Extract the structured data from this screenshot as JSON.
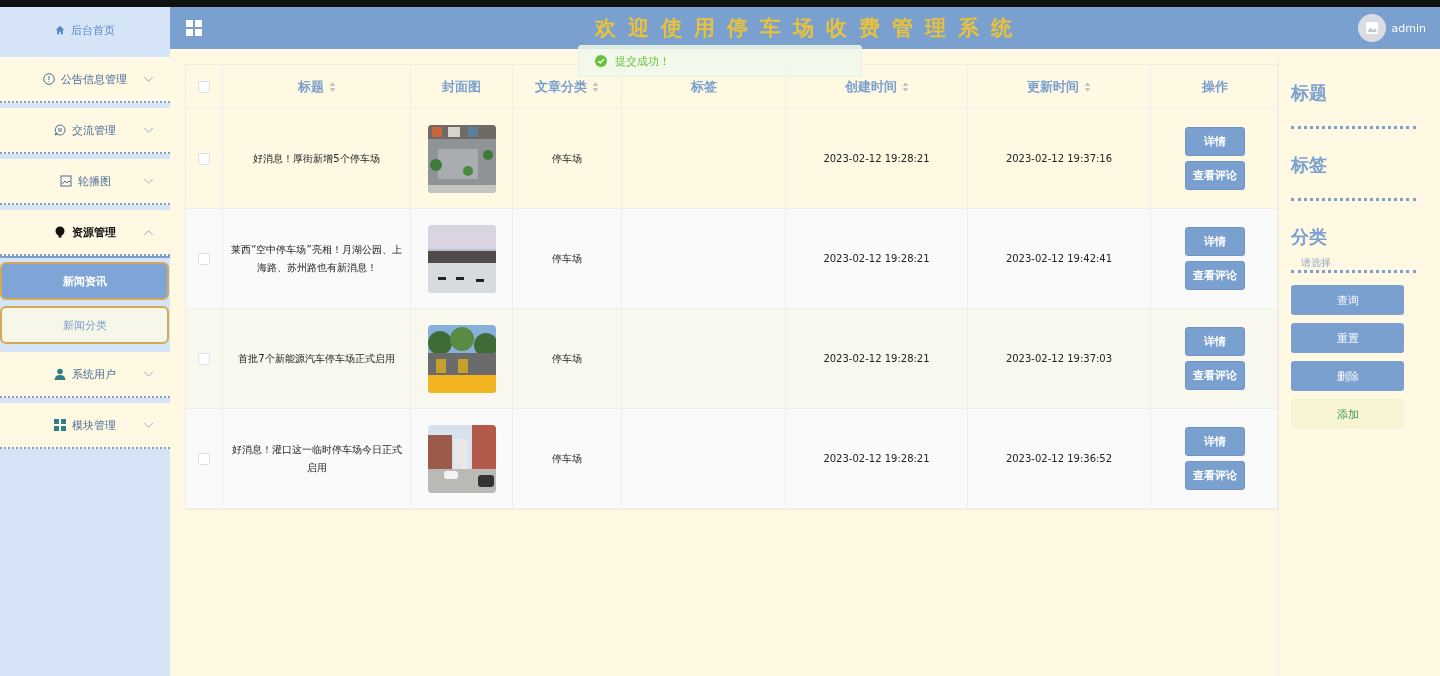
{
  "header": {
    "home": "后台首页",
    "title": "欢迎使用停车场收费管理系统",
    "user": "admin"
  },
  "toast": {
    "message": "提交成功！"
  },
  "sidebar": {
    "items": [
      {
        "label": "公告信息管理",
        "expanded": false
      },
      {
        "label": "交流管理",
        "expanded": false
      },
      {
        "label": "轮播图",
        "expanded": false
      },
      {
        "label": "资源管理",
        "expanded": true,
        "children": [
          {
            "label": "新闻资讯",
            "selected": true
          },
          {
            "label": "新闻分类",
            "selected": false
          }
        ]
      },
      {
        "label": "系统用户",
        "expanded": false
      },
      {
        "label": "模块管理",
        "expanded": false
      }
    ]
  },
  "table": {
    "select_all": {
      "checked": false
    },
    "columns": [
      {
        "label": "标题",
        "sortable": true
      },
      {
        "label": "封面图",
        "sortable": false
      },
      {
        "label": "文章分类",
        "sortable": true
      },
      {
        "label": "标签",
        "sortable": false
      },
      {
        "label": "创建时间",
        "sortable": true
      },
      {
        "label": "更新时间",
        "sortable": true
      },
      {
        "label": "操作",
        "sortable": false
      }
    ],
    "rows": [
      {
        "checked": false,
        "title": "好消息！厚街新增5个停车场",
        "cover": {
          "kind": "picture"
        },
        "category": "停车场",
        "created": "2023-02-12 19:28:21",
        "updated": "2023-02-12 19:37:16",
        "actions": [
          "详情",
          "查看评论"
        ]
      },
      {
        "checked": false,
        "title": "莱西“空中停车场”亮相！月湖公园、上海路、苏州路也有新消息！",
        "cover": {
          "kind": "picture"
        },
        "category": "停车场",
        "created": "2023-02-12 19:28:21",
        "updated": "2023-02-12 19:42:41",
        "actions": [
          "详情",
          "查看评论"
        ]
      },
      {
        "checked": false,
        "title": "首批7个新能源汽车停车场正式启用",
        "cover": {
          "kind": "picture"
        },
        "category": "停车场",
        "created": "2023-02-12 19:28:21",
        "updated": "2023-02-12 19:37:03",
        "actions": [
          "详情",
          "查看评论"
        ]
      },
      {
        "checked": false,
        "title": "好消息！灌口这一临时停车场今日正式启用",
        "cover": {
          "kind": "picture"
        },
        "category": "停车场",
        "created": "2023-02-12 19:28:21",
        "updated": "2023-02-12 19:36:52",
        "actions": [
          "详情",
          "查看评论"
        ]
      }
    ]
  },
  "filters": {
    "fields": [
      {
        "label": "标题"
      },
      {
        "label": "标签"
      },
      {
        "label": "分类",
        "placeholder": "请选择"
      }
    ],
    "buttons": [
      {
        "label": "查询",
        "kind": "primary"
      },
      {
        "label": "重置",
        "kind": "primary"
      },
      {
        "label": "删除",
        "kind": "primary"
      },
      {
        "label": "添加",
        "kind": "light"
      }
    ]
  }
}
